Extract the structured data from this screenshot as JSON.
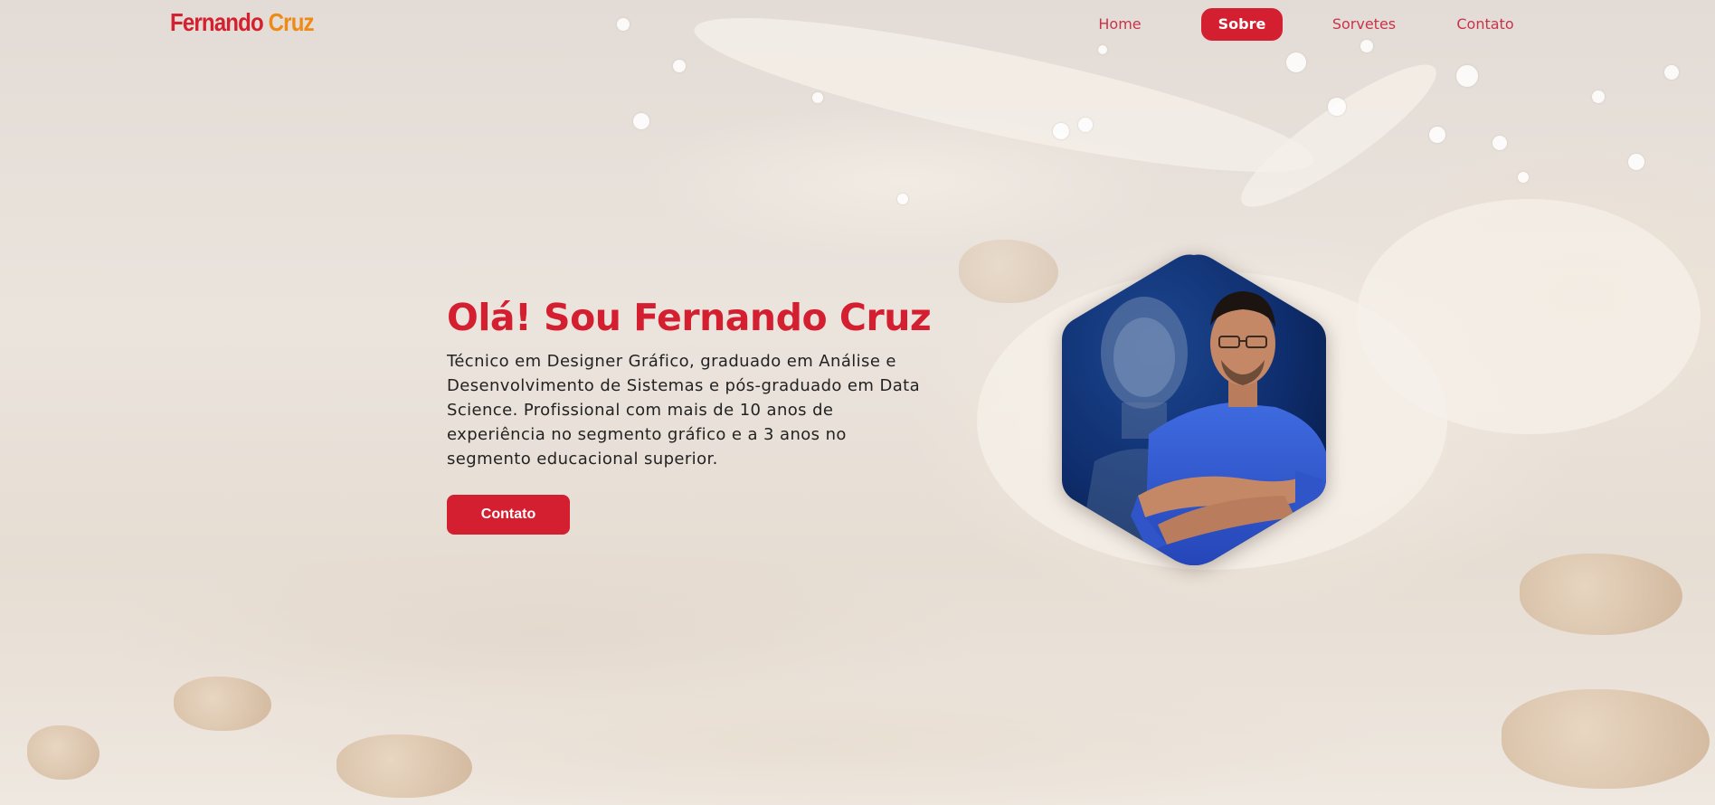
{
  "brand": {
    "first": "Fernando",
    "last": "Cruz"
  },
  "nav": {
    "items": [
      {
        "label": "Home",
        "active": false
      },
      {
        "label": "Sobre",
        "active": true
      },
      {
        "label": "Sorvetes",
        "active": false
      },
      {
        "label": "Contato",
        "active": false
      }
    ]
  },
  "hero": {
    "title": "Olá! Sou Fernando Cruz",
    "description": "Técnico em Designer Gráfico, graduado em Análise e Desenvolvimento de Sistemas e pós-graduado em Data Science. Profissional com mais de 10 anos de experiência no segmento gráfico e a 3 anos no segmento educacional superior.",
    "cta_label": "Contato",
    "portrait_icon": "profile-photo"
  },
  "colors": {
    "accent": "#d41f31",
    "brand_secondary": "#ee8a15",
    "portrait_bg": "#0f2e6e"
  }
}
